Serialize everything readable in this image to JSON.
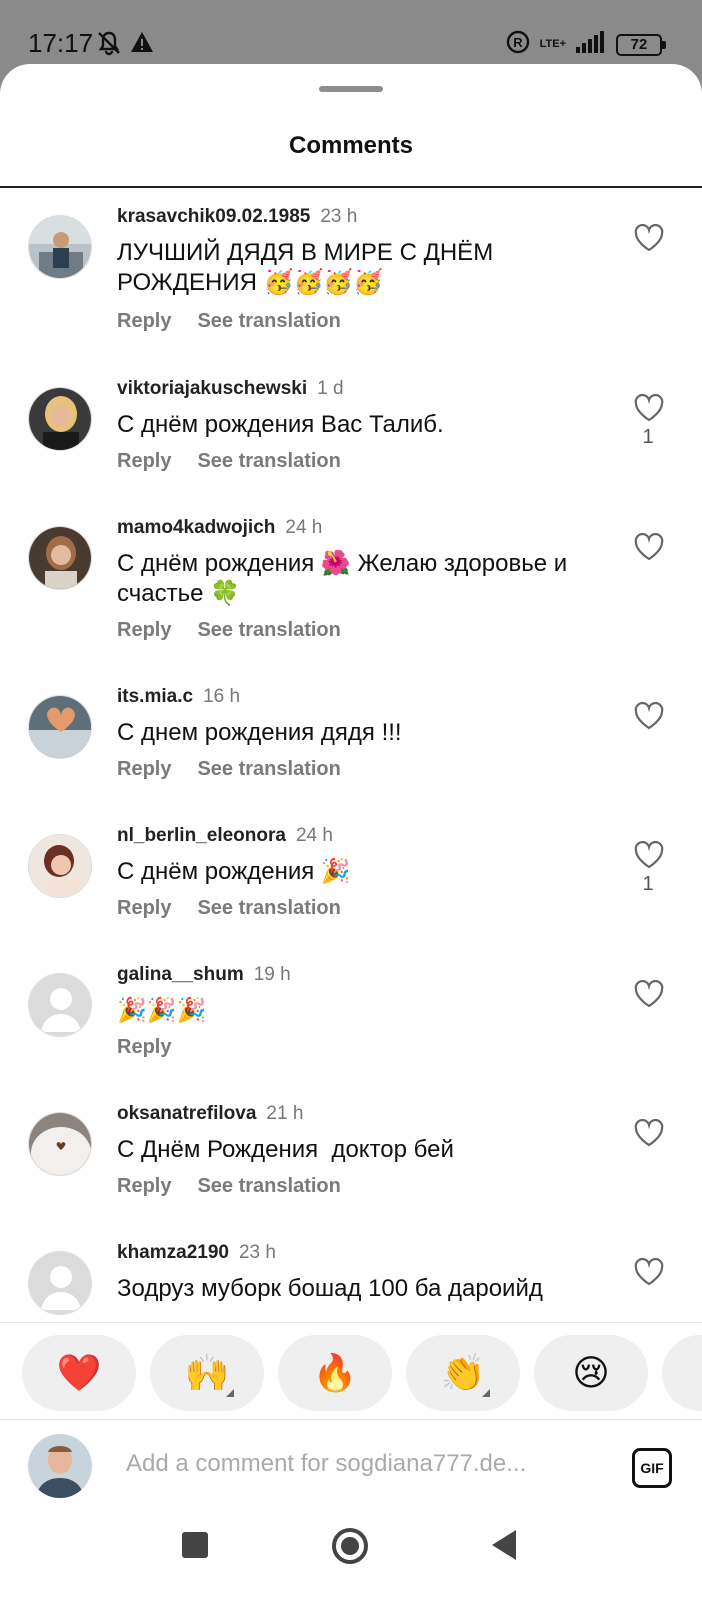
{
  "status_bar": {
    "time": "17:17",
    "network": "LTE+",
    "battery": "72",
    "icons": [
      "bell-off-icon",
      "warning-icon",
      "registered-icon",
      "signal-icon",
      "battery-icon"
    ]
  },
  "sheet": {
    "title": "Comments"
  },
  "comments": [
    {
      "user": "krasavchik09.02.1985",
      "time": "23 h",
      "text": "ЛУЧШИЙ ДЯДЯ В МИРЕ С ДНЁМ РОЖДЕНИЯ 🥳🥳🥳🥳",
      "reply": "Reply",
      "translate": "See translation",
      "likes": ""
    },
    {
      "user": "viktoriajakuschewski",
      "time": "1 d",
      "text": "С днём рождения Вас Талиб.",
      "reply": "Reply",
      "translate": "See translation",
      "likes": "1"
    },
    {
      "user": "mamo4kadwojich",
      "time": "24 h",
      "text": "С днём рождения 🌺 Желаю здоровье и счастье 🍀",
      "reply": "Reply",
      "translate": "See translation",
      "likes": ""
    },
    {
      "user": "its.mia.c",
      "time": "16 h",
      "text": "С днем рождения дядя !!!",
      "reply": "Reply",
      "translate": "See translation",
      "likes": ""
    },
    {
      "user": "nl_berlin_eleonora",
      "time": "24 h",
      "text": "С днём рождения 🎉",
      "reply": "Reply",
      "translate": "See translation",
      "likes": "1"
    },
    {
      "user": "galina__shum",
      "time": "19 h",
      "text": "🎉🎉🎉",
      "reply": "Reply",
      "translate": "",
      "likes": ""
    },
    {
      "user": "oksanatrefilova",
      "time": "21 h",
      "text": "С Днём Рождения  доктор бей",
      "reply": "Reply",
      "translate": "See translation",
      "likes": ""
    },
    {
      "user": "khamza2190",
      "time": "23 h",
      "text": "Зодруз муборк бошад 100 ба дароийд",
      "reply": "",
      "translate": "",
      "likes": ""
    }
  ],
  "reactions": [
    "❤️",
    "🙌",
    "🔥",
    "👏",
    "😢"
  ],
  "add_comment": {
    "placeholder": "Add a comment for sogdiana777.de...",
    "gif_label": "GIF"
  },
  "nav": {
    "icons": [
      "recents-icon",
      "home-icon",
      "back-icon"
    ]
  }
}
